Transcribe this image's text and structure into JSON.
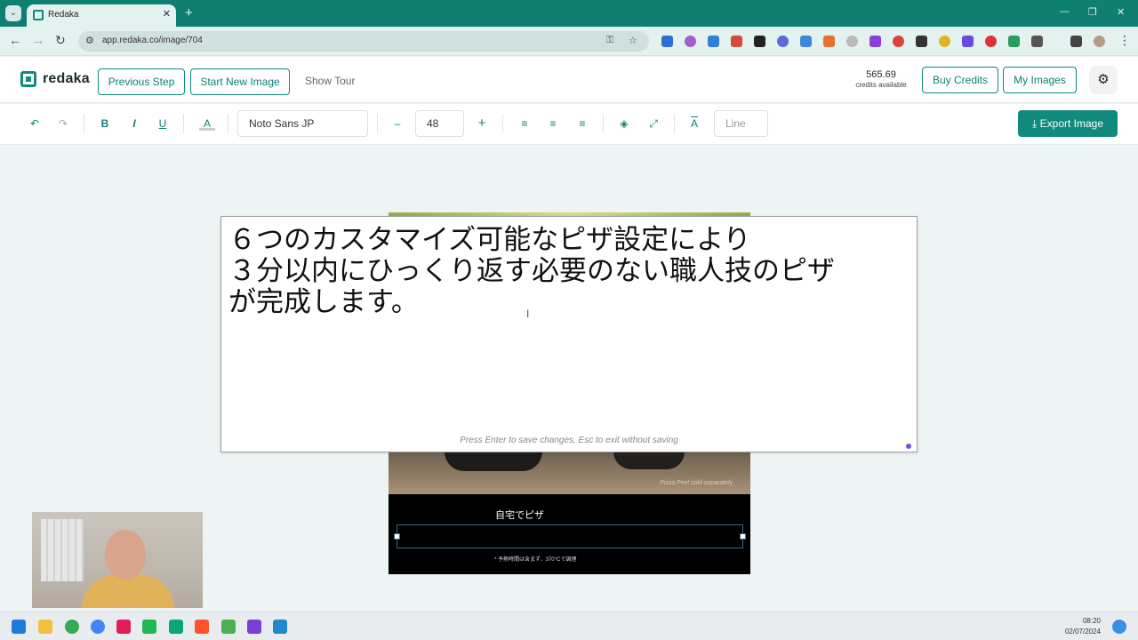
{
  "browser": {
    "tab_title": "Redaka",
    "new_tab": "+",
    "tab_close": "✕",
    "url": "app.redaka.co/image/704",
    "window_controls": [
      "—",
      "❐",
      "✕"
    ]
  },
  "app": {
    "logo": "redaka",
    "buttons": {
      "previous_step": "Previous Step",
      "start_new_image": "Start New Image",
      "show_tour": "Show Tour",
      "buy_credits": "Buy Credits",
      "my_images": "My Images"
    },
    "credits": {
      "value": "565.69",
      "label": "credits available"
    }
  },
  "toolbar": {
    "undo": "↶",
    "redo": "↷",
    "bold": "B",
    "italic": "I",
    "underline": "U",
    "text_color": "A",
    "font_family": "Noto Sans JP",
    "decrease": "–",
    "font_size": "48",
    "increase": "+",
    "line_placeholder": "Line",
    "export_label": "Export Image",
    "accent_color": "#0f8a7c"
  },
  "editor": {
    "text_lines": [
      "６つのカスタマイズ可能なピザ設定により",
      "３分以内にひっくり返す必要のない職人技のピザ",
      "が完成します。"
    ],
    "hint": "Press Enter to save changes, Esc to exit without saving"
  },
  "image": {
    "photo_caption": "Pizza Peel sold separately",
    "heading": "自宅でピザ",
    "footnote": "* 予熱時間は含まず、370°Cで調理"
  },
  "taskbar": {
    "time": "08:20",
    "date": "02/07/2024"
  }
}
